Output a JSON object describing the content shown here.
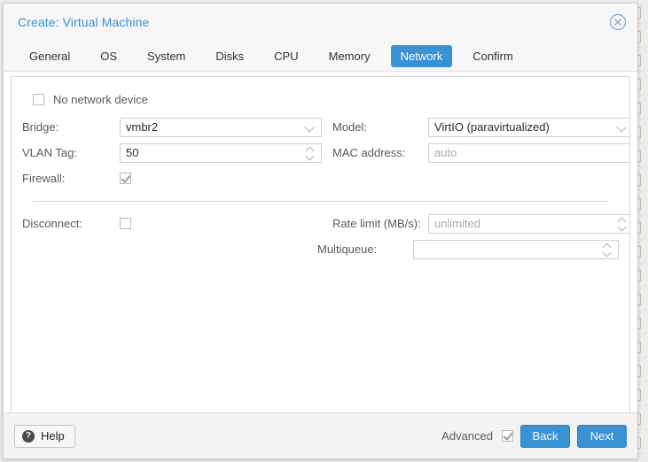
{
  "window": {
    "title": "Create: Virtual Machine",
    "close_icon": "close-circle-icon",
    "accent_color": "#3892d4"
  },
  "tabs": [
    {
      "label": "General",
      "active": false
    },
    {
      "label": "OS",
      "active": false
    },
    {
      "label": "System",
      "active": false
    },
    {
      "label": "Disks",
      "active": false
    },
    {
      "label": "CPU",
      "active": false
    },
    {
      "label": "Memory",
      "active": false
    },
    {
      "label": "Network",
      "active": true
    },
    {
      "label": "Confirm",
      "active": false
    }
  ],
  "form": {
    "no_network_device": {
      "label": "No network device",
      "checked": false
    },
    "left": {
      "bridge": {
        "label": "Bridge:",
        "value": "vmbr2",
        "control": "combobox"
      },
      "vlan_tag": {
        "label": "VLAN Tag:",
        "value": "50",
        "control": "spinner"
      },
      "firewall": {
        "label": "Firewall:",
        "checked": true
      },
      "disconnect": {
        "label": "Disconnect:",
        "checked": false
      }
    },
    "right": {
      "model": {
        "label": "Model:",
        "value": "VirtIO (paravirtualized)",
        "control": "combobox"
      },
      "mac_address": {
        "label": "MAC address:",
        "value": "",
        "placeholder": "auto",
        "control": "text"
      },
      "rate_limit": {
        "label": "Rate limit (MB/s):",
        "value": "",
        "placeholder": "unlimited",
        "control": "spinner"
      },
      "multiqueue": {
        "label": "Multiqueue:",
        "value": "",
        "placeholder": "",
        "control": "spinner"
      }
    }
  },
  "footer": {
    "help_label": "Help",
    "help_icon": "question-mark-icon",
    "advanced_label": "Advanced",
    "advanced_checked": true,
    "back_label": "Back",
    "next_label": "Next"
  }
}
